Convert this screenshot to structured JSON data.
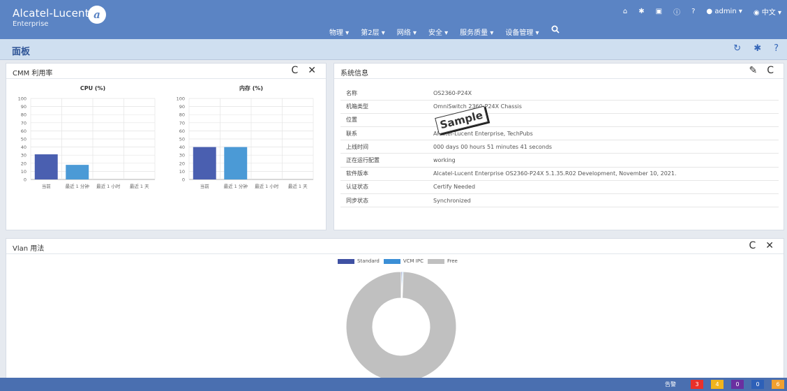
{
  "brand": {
    "name": "Alcatel-Lucent",
    "sub": "Enterprise",
    "logo": "alu-logo"
  },
  "topbar": {
    "home_icon": "home-icon",
    "user": "admin ▾",
    "lang": "中文 ▾"
  },
  "nav": [
    {
      "label": "物理 ▾"
    },
    {
      "label": "第2层 ▾"
    },
    {
      "label": "网络 ▾"
    },
    {
      "label": "安全 ▾"
    },
    {
      "label": "服务质量 ▾"
    },
    {
      "label": "设备管理 ▾"
    }
  ],
  "dashboard": {
    "title": "面板"
  },
  "cmm": {
    "title": "CMM 利用率",
    "refresh": "C",
    "close": "✕"
  },
  "chart_data": [
    {
      "type": "bar",
      "title": "CPU (%)",
      "categories": [
        "当前",
        "最近 1 分钟",
        "最近 1 小时",
        "最近 1 天"
      ],
      "values": [
        31,
        18,
        0,
        0
      ],
      "colors": [
        "#4a5fb0",
        "#4b9ad6",
        "#4b9ad6",
        "#4b9ad6"
      ],
      "ylim": [
        0,
        100
      ],
      "yticks": [
        0,
        10,
        20,
        30,
        40,
        50,
        60,
        70,
        80,
        90,
        100
      ],
      "grid": true
    },
    {
      "type": "bar",
      "title": "内存 (%)",
      "categories": [
        "当前",
        "最近 1 分钟",
        "最近 1 小时",
        "最近 1 天"
      ],
      "values": [
        40,
        40,
        0,
        0
      ],
      "colors": [
        "#4a5fb0",
        "#4b9ad6",
        "#4b9ad6",
        "#4b9ad6"
      ],
      "ylim": [
        0,
        100
      ],
      "yticks": [
        0,
        10,
        20,
        30,
        40,
        50,
        60,
        70,
        80,
        90,
        100
      ],
      "grid": true
    },
    {
      "type": "pie",
      "labels": [
        "Standard",
        "VCM IPC",
        "Free"
      ],
      "values": [
        0.3,
        0.3,
        99.4
      ],
      "colors": [
        "#3f51a3",
        "#3b8fd6",
        "#c0c0c0"
      ],
      "legend": "top"
    }
  ],
  "sysinfo": {
    "title": "系统信息",
    "rows": [
      {
        "k": "名称",
        "v": "OS2360-P24X"
      },
      {
        "k": "机箱类型",
        "v": "OmniSwitch 2360-P24X Chassis"
      },
      {
        "k": "位置",
        "v": ""
      },
      {
        "k": "联系",
        "v": "Alcatel-Lucent Enterprise, TechPubs"
      },
      {
        "k": "上线时间",
        "v": "000 days 00 hours 51 minutes 41 seconds"
      },
      {
        "k": "正在运行配置",
        "v": "working"
      },
      {
        "k": "软件版本",
        "v": "Alcatel-Lucent Enterprise OS2360-P24X 5.1.35.R02 Development, November 10, 2021."
      },
      {
        "k": "认证状态",
        "v": "Certify Needed"
      },
      {
        "k": "同步状态",
        "v": "Synchronized"
      }
    ],
    "watermark": "Sample"
  },
  "vlan": {
    "title": "Vlan 用法"
  },
  "footer": {
    "alarm_label": "告警",
    "badges": [
      {
        "v": "3",
        "color": "#e8302a"
      },
      {
        "v": "4",
        "color": "#f0b41c"
      },
      {
        "v": "0",
        "color": "#6a2fa0"
      },
      {
        "v": "0",
        "color": "#2d60b8"
      },
      {
        "v": "6",
        "color": "#f0a030"
      }
    ]
  }
}
